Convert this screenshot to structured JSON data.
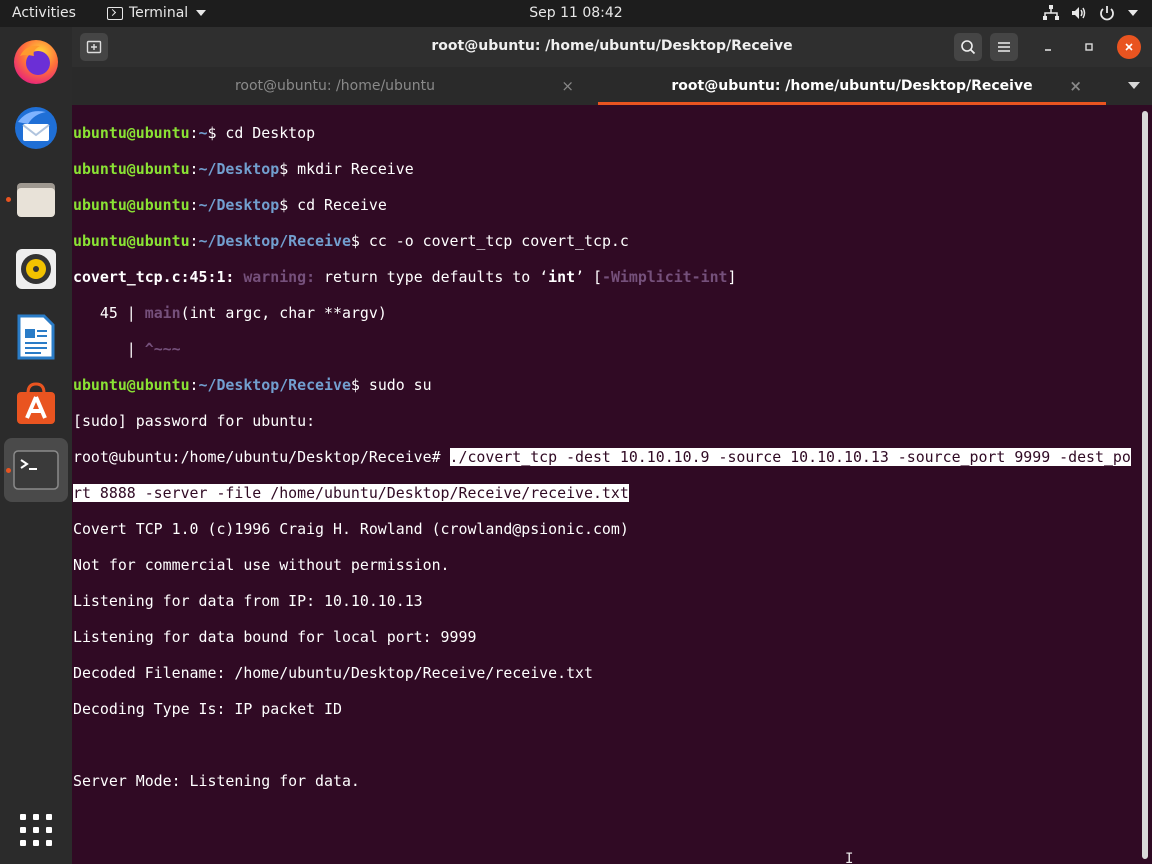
{
  "topbar": {
    "activities": "Activities",
    "app_name": "Terminal",
    "clock": "Sep 11  08:42"
  },
  "dock": {
    "items": [
      {
        "name": "firefox-icon",
        "color": "#ff7139"
      },
      {
        "name": "thunderbird-icon",
        "color": "#1f6fd6"
      },
      {
        "name": "files-icon",
        "color": "#d9d2c6"
      },
      {
        "name": "rhythmbox-icon",
        "color": "#f2c200"
      },
      {
        "name": "libreoffice-writer-icon",
        "color": "#2a7cc7"
      },
      {
        "name": "ubuntu-software-icon",
        "color": "#e95420"
      },
      {
        "name": "terminal-icon",
        "color": "#3a3a3a"
      }
    ],
    "show_apps_icon": "grid-icon"
  },
  "window": {
    "title": "root@ubuntu: /home/ubuntu/Desktop/Receive",
    "tabs": [
      {
        "label": "root@ubuntu: /home/ubuntu",
        "close": "×"
      },
      {
        "label": "root@ubuntu: /home/ubuntu/Desktop/Receive",
        "close": "×"
      }
    ]
  },
  "terminal": {
    "user_host": "ubuntu@ubuntu",
    "l1_path": "~",
    "l1_cmd": "$ cd Desktop",
    "l2_path": "~/Desktop",
    "l2_cmd": "$ mkdir Receive",
    "l3_path": "~/Desktop",
    "l3_cmd": "$ cd Receive",
    "l4_path": "~/Desktop/Receive",
    "l4_cmd": "$ cc -o covert_tcp covert_tcp.c",
    "l5_loc": "covert_tcp.c:45:1:",
    "l5_warn": "warning:",
    "l5_msg_a": " return type defaults to ‘",
    "l5_int": "int",
    "l5_msg_b": "’ [",
    "l5_flag": "-Wimplicit-int",
    "l5_msg_c": "]",
    "l6_num": "   45 | ",
    "l6_main": "main",
    "l6_rest": "(int argc, char **argv)",
    "l7_bar": "      | ",
    "l7_caret": "^~~~",
    "l8_path": "~/Desktop/Receive",
    "l8_cmd": "$ sudo su",
    "l9": "[sudo] password for ubuntu:",
    "l10_prompt": "root@ubuntu:/home/ubuntu/Desktop/Receive# ",
    "l10_cmd": "./covert_tcp -dest 10.10.10.9 -source 10.10.10.13 -source_port 9999 -dest_po",
    "l11_cmd": "rt 8888 -server -file /home/ubuntu/Desktop/Receive/receive.txt",
    "l12": "Covert TCP 1.0 (c)1996 Craig H. Rowland (crowland@psionic.com)",
    "l13": "Not for commercial use without permission.",
    "l14": "Listening for data from IP: 10.10.10.13",
    "l15": "Listening for data bound for local port: 9999",
    "l16": "Decoded Filename: /home/ubuntu/Desktop/Receive/receive.txt",
    "l17": "Decoding Type Is: IP packet ID",
    "l18": "",
    "l19": "Server Mode: Listening for data."
  }
}
